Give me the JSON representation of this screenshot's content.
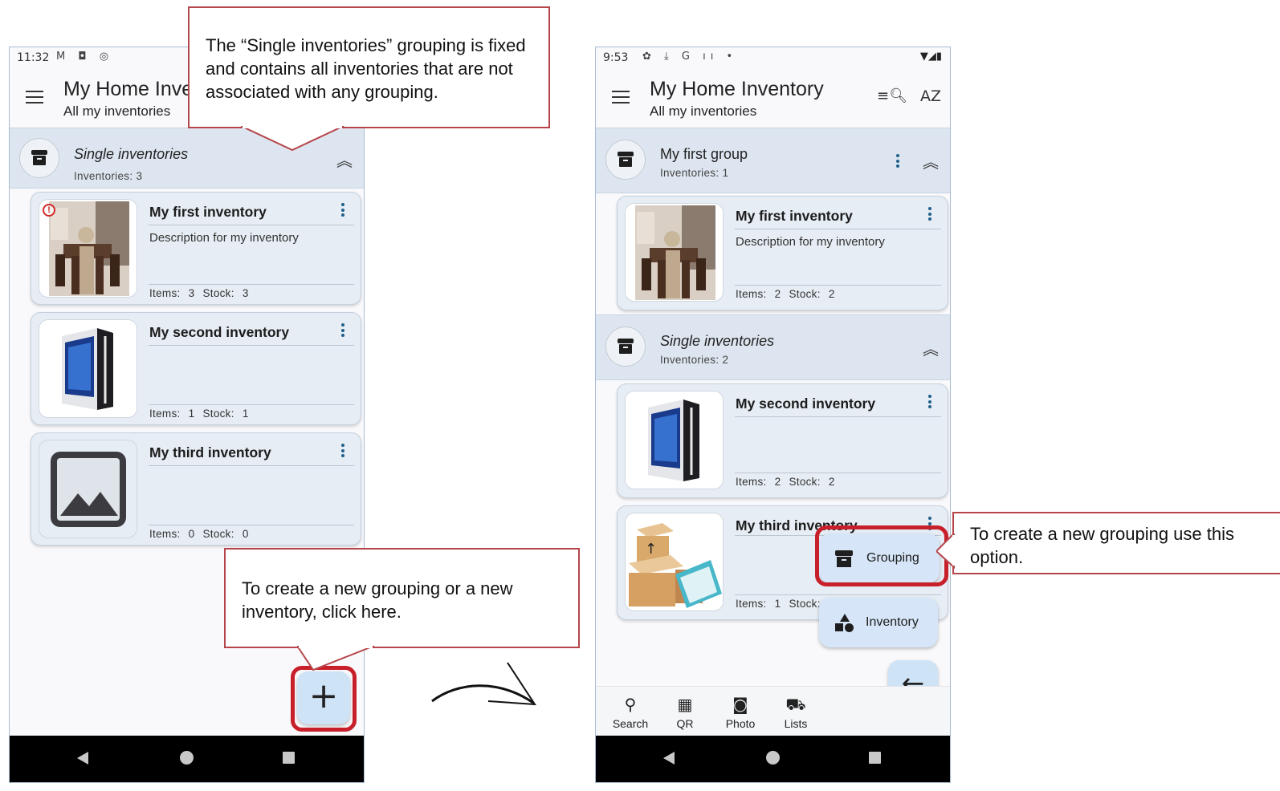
{
  "left_screen": {
    "status_time": "11:32",
    "status_icons": "M ◘ ◎",
    "app_title": "My Home Inve",
    "app_subtitle": "All my inventories",
    "group": {
      "name": "Single inventories",
      "count": "Inventories: 3"
    },
    "cards": [
      {
        "name": "My first inventory",
        "description": "Description for my inventory",
        "meta": "Items: 3   Stock: 3",
        "image": "dining-room-photo"
      },
      {
        "name": "My second inventory",
        "description": "",
        "meta": "Items: 1   Stock: 1",
        "image": "pc-tower-photo"
      },
      {
        "name": "My third inventory",
        "description": "",
        "meta": "Items: 0   Stock: 0",
        "image": "image-placeholder-icon"
      }
    ],
    "fab_label": "+"
  },
  "right_screen": {
    "status_time": "9:53",
    "status_icons": "✿ ⤓ G ıı •",
    "status_right": "▼◢▮",
    "app_title": "My Home Inventory",
    "app_subtitle": "All my inventories",
    "groups": [
      {
        "name": "My first group",
        "count": "Inventories: 1"
      },
      {
        "name": "Single inventories",
        "count": "Inventories: 2"
      }
    ],
    "cards": [
      {
        "name": "My first inventory",
        "description": "Description for my inventory",
        "meta": "Items: 2   Stock: 2",
        "image": "dining-room-photo"
      },
      {
        "name": "My second inventory",
        "description": "",
        "meta": "Items: 2   Stock: 2",
        "image": "pc-tower-photo"
      },
      {
        "name": "My third inventory",
        "description": "",
        "meta": "Items: 1   Stock:",
        "image": "boxes-photo"
      }
    ],
    "menu": {
      "grouping": "Grouping",
      "inventory": "Inventory"
    },
    "bottom_nav": [
      "Search",
      "QR",
      "Photo",
      "Lists"
    ]
  },
  "callouts": {
    "top": "The “Single inventories” grouping is fixed and contains all inventories that are not associated with any grouping.",
    "fab": "To create a new grouping or a new inventory, click here.",
    "grouping": "To create a new grouping use this option."
  },
  "colors": {
    "accent_red": "#c8202a",
    "header_bg": "#dde6f0",
    "card_bg": "#e6edf4",
    "kebab": "#1f5f8b"
  }
}
